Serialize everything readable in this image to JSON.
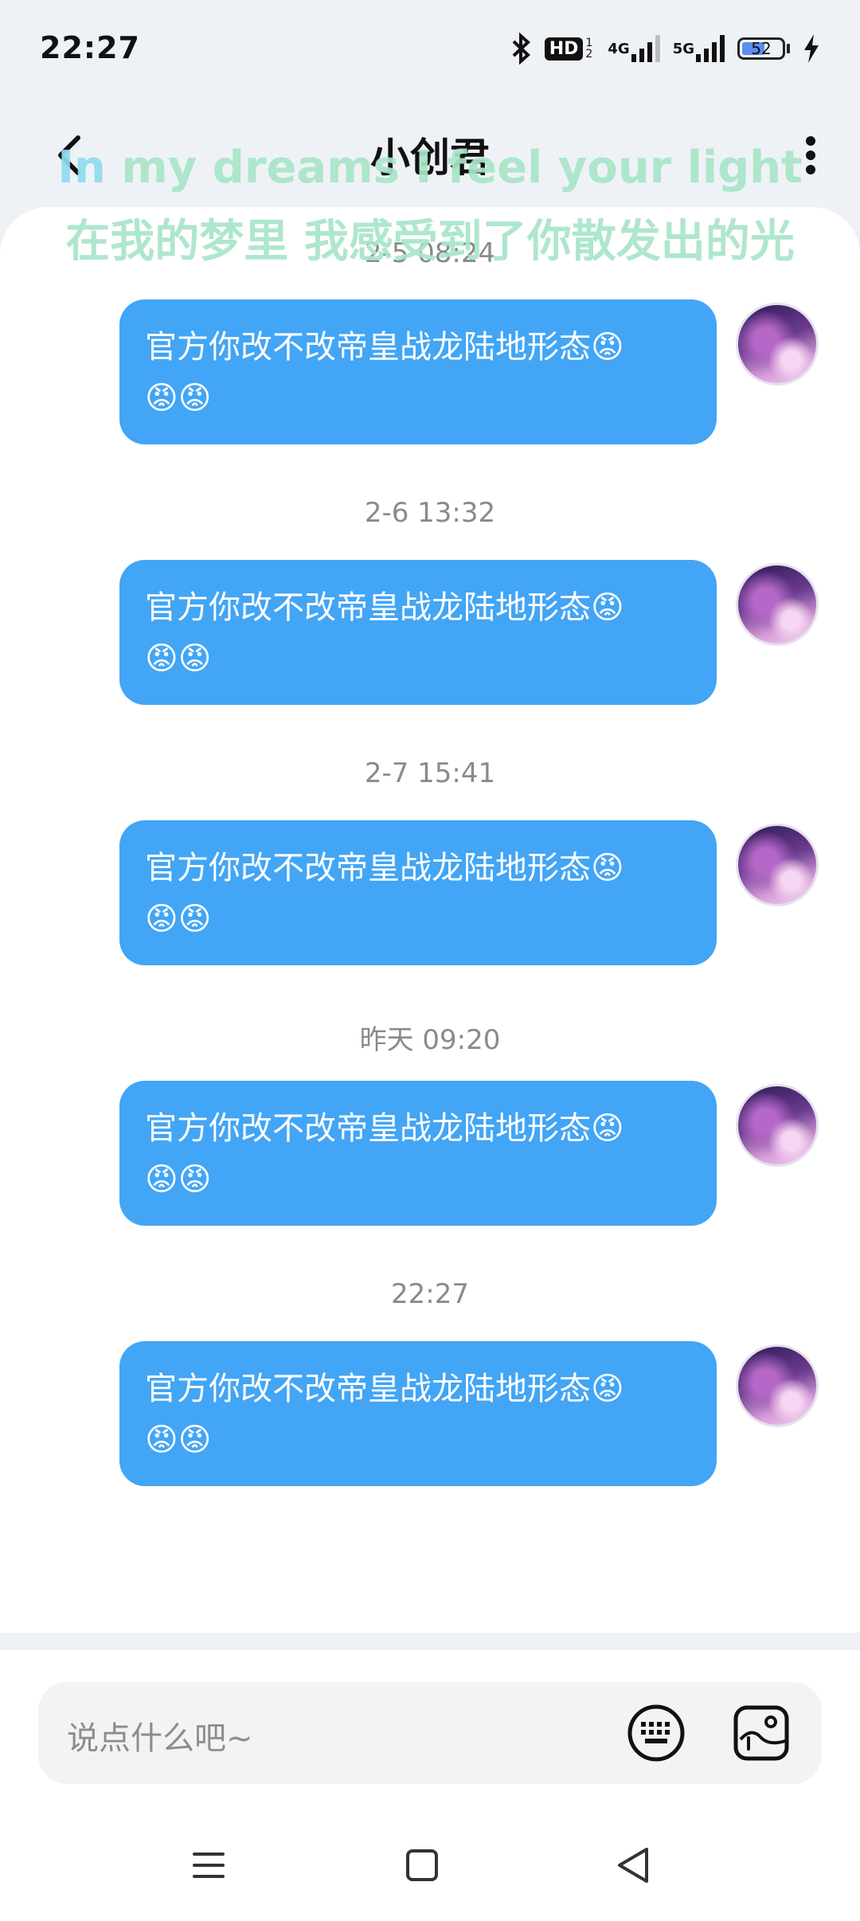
{
  "status_bar": {
    "time": "22:27",
    "hd_label": "HD",
    "hd_sub": "1 2",
    "network_4g": "4G",
    "network_5g": "5G",
    "battery_percent": "52"
  },
  "header": {
    "title": "小创君"
  },
  "lyrics": {
    "line1_prefix": "In",
    "line1_rest": " my dreams I feel your light",
    "line2": "在我的梦里 我感受到了你散发出的光"
  },
  "messages": [
    {
      "timestamp": "2-5 08:24",
      "line1": "官方你改不改帝皇战龙陆地形态😡",
      "line2": "😡😡"
    },
    {
      "timestamp": "2-6 13:32",
      "line1": "官方你改不改帝皇战龙陆地形态😡",
      "line2": "😡😡"
    },
    {
      "timestamp": "2-7 15:41",
      "line1": "官方你改不改帝皇战龙陆地形态😡",
      "line2": "😡😡"
    },
    {
      "timestamp": "昨天 09:20",
      "line1": "官方你改不改帝皇战龙陆地形态😡",
      "line2": "😡😡"
    },
    {
      "timestamp": "22:27",
      "line1": "官方你改不改帝皇战龙陆地形态😡",
      "line2": "😡😡"
    }
  ],
  "input": {
    "placeholder": "说点什么吧~"
  },
  "colors": {
    "bubble": "#42a5f5",
    "lyric": "#a8e6c8",
    "background": "#eef2f6"
  }
}
